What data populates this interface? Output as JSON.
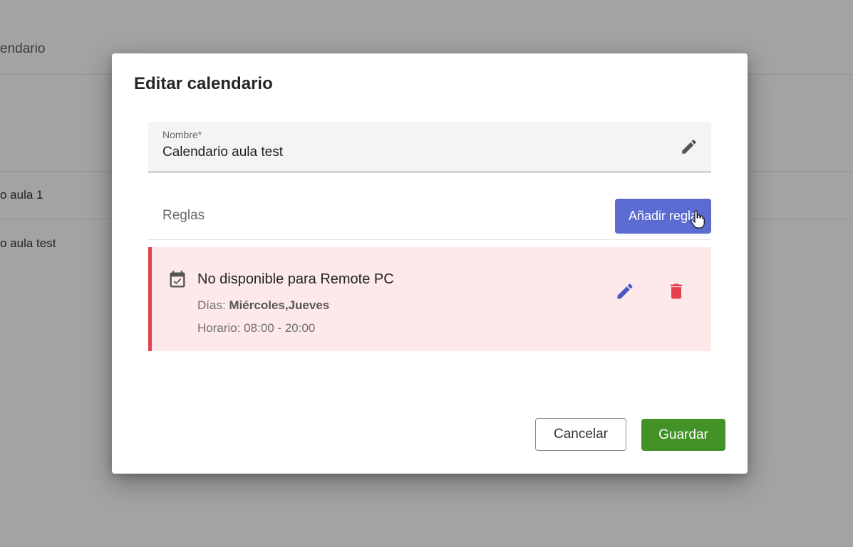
{
  "background": {
    "tab_label": "endario",
    "rows": [
      "o aula 1",
      "o aula test"
    ]
  },
  "dialog": {
    "title": "Editar calendario",
    "name_field": {
      "label": "Nombre*",
      "value": "Calendario aula test",
      "icon": "pencil-icon"
    },
    "rules": {
      "label": "Reglas",
      "add_button": "Añadir regla",
      "items": [
        {
          "icon": "calendar-check-icon",
          "title": "No disponible para Remote PC",
          "days_label": "Días:",
          "days_value": "Miércoles,Jueves",
          "hours": "Horario: 08:00 - 20:00",
          "accent_color": "#e5414d",
          "background_color": "#fde9ea"
        }
      ]
    },
    "buttons": {
      "cancel": "Cancelar",
      "save": "Guardar"
    }
  },
  "colors": {
    "primary": "#5b6bd1",
    "success": "#429228",
    "danger": "#e5414d",
    "overlay": "#a3a3a3"
  }
}
